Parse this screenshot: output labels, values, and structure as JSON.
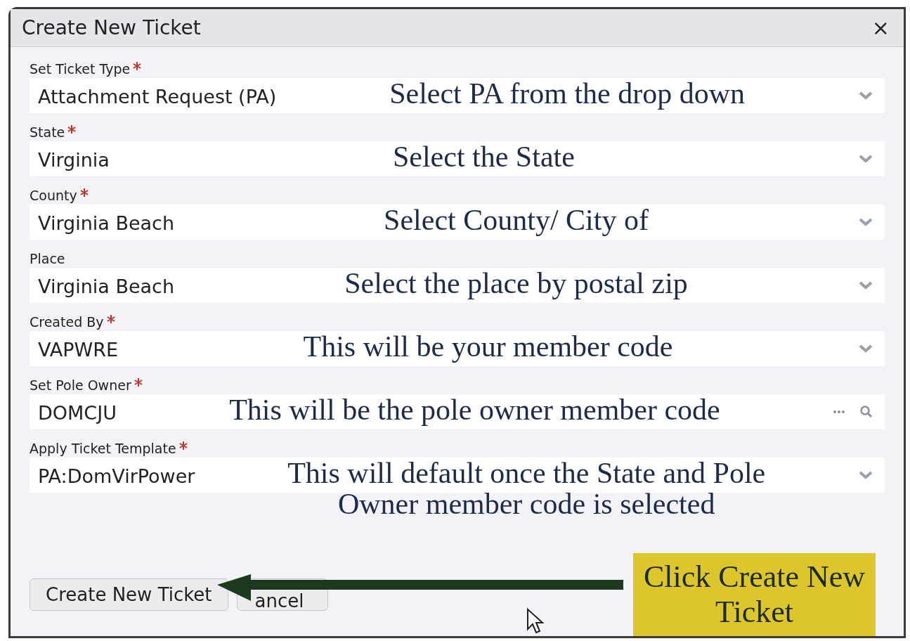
{
  "dialog": {
    "title": "Create New Ticket",
    "close": "×"
  },
  "fields": [
    {
      "label": "Set Ticket Type",
      "required": true,
      "value": "Attachment Request (PA)",
      "kind": "dropdown",
      "annotation": "Select PA from the drop down"
    },
    {
      "label": "State",
      "required": true,
      "value": "Virginia",
      "kind": "dropdown",
      "annotation": "Select the State"
    },
    {
      "label": "County",
      "required": true,
      "value": "Virginia Beach",
      "kind": "dropdown",
      "annotation": "Select County/ City of"
    },
    {
      "label": "Place",
      "required": false,
      "value": "Virginia Beach",
      "kind": "dropdown",
      "annotation": "Select the place by postal zip"
    },
    {
      "label": "Created By",
      "required": true,
      "value": "VAPWRE",
      "kind": "dropdown",
      "annotation": "This will be your member code"
    },
    {
      "label": "Set Pole Owner",
      "required": true,
      "value": "DOMCJU",
      "kind": "lookup",
      "annotation": "This will be the pole owner member code"
    },
    {
      "label": "Apply Ticket Template",
      "required": true,
      "value": "PA:DomVirPower",
      "kind": "dropdown",
      "annotation": "This will default once the State and Pole Owner member code is selected"
    }
  ],
  "buttons": [
    "Create New Ticket",
    "ancel"
  ],
  "callout": "Click Create New Ticket"
}
